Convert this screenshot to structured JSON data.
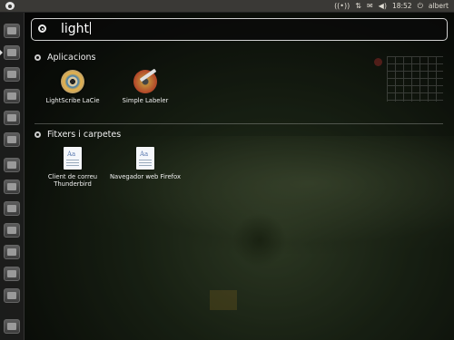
{
  "panel": {
    "time": "18:52",
    "user": "albert"
  },
  "search": {
    "query": "light"
  },
  "sections": {
    "apps": {
      "title": "Aplicacions",
      "items": [
        {
          "label": "LightScribe LaCie",
          "icon": "disc-icon"
        },
        {
          "label": "Simple Labeler",
          "icon": "label-disc-icon"
        }
      ]
    },
    "files": {
      "title": "Fitxers i carpetes",
      "items": [
        {
          "label": "Client de correu Thunderbird",
          "icon": "document-icon"
        },
        {
          "label": "Navegador web Firefox",
          "icon": "document-icon"
        }
      ]
    }
  },
  "launcher": {
    "items": [
      "home-folder",
      "browser",
      "mail",
      "office",
      "files",
      "terminal",
      "settings",
      "disk",
      "workspace",
      "apps",
      "search",
      "trash"
    ]
  }
}
